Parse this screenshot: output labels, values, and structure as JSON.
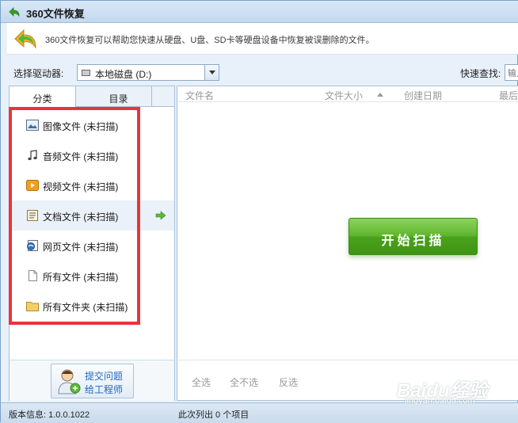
{
  "window": {
    "title": "360文件恢复"
  },
  "banner": {
    "description": "360文件恢复可以帮助您快速从硬盘、U盘、SD卡等硬盘设备中恢复被误删除的文件。"
  },
  "toolbar": {
    "drive_label": "选择驱动器:",
    "drive_value": "本地磁盘 (D:)",
    "quick_search_label": "快速查找:",
    "quick_search_placeholder": "输入"
  },
  "tabs": [
    {
      "label": "分类",
      "active": true
    },
    {
      "label": "目录",
      "active": false
    }
  ],
  "categories": [
    {
      "label": "图像文件 (未扫描)",
      "icon": "image-icon"
    },
    {
      "label": "音频文件 (未扫描)",
      "icon": "music-note-icon"
    },
    {
      "label": "视频文件 (未扫描)",
      "icon": "video-icon"
    },
    {
      "label": "文档文件 (未扫描)",
      "icon": "document-icon",
      "selected": true
    },
    {
      "label": "网页文件 (未扫描)",
      "icon": "webpage-icon"
    },
    {
      "label": "所有文件 (未扫描)",
      "icon": "blank-file-icon"
    },
    {
      "label": "所有文件夹 (未扫描)",
      "icon": "folder-icon"
    }
  ],
  "help_button": {
    "line1": "提交问题",
    "line2": "给工程师"
  },
  "columns": [
    "文件名",
    "文件大小",
    "创建日期",
    "最后"
  ],
  "scan_button": "开始扫描",
  "bottom_links": [
    "全选",
    "全不选",
    "反选"
  ],
  "status": {
    "version": "版本信息: 1.0.0.1022",
    "count": "此次列出 0 个项目"
  },
  "watermark": {
    "main": "Baidu经验",
    "sub": "jingyan.baidu.com"
  },
  "colors": {
    "accent_green": "#4aa31c",
    "highlight_red": "#e8353a",
    "link_blue": "#2266bb"
  }
}
